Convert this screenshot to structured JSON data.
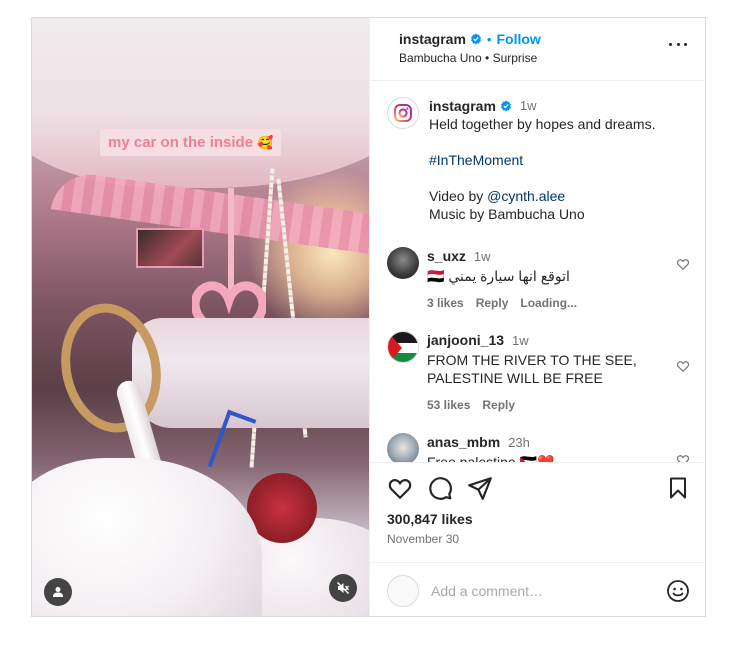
{
  "media": {
    "caption_sticker": "my car on the inside",
    "caption_emoji": "🥰"
  },
  "header": {
    "username": "instagram",
    "separator": "•",
    "follow_label": "Follow",
    "subline": "Bambucha Uno • Surprise"
  },
  "caption": {
    "username": "instagram",
    "time": "1w",
    "line1": "Held together by hopes and dreams.",
    "hashtag": "#InTheMoment",
    "video_by_prefix": "Video by ",
    "video_by_handle": "@cynth.alee",
    "music_by": "Music by Bambucha Uno"
  },
  "comments": [
    {
      "username": "s_uxz",
      "time": "1w",
      "flag": "🇾🇪",
      "text": "اتوقع انها سيارة يمني",
      "likes": "3 likes",
      "reply": "Reply",
      "loading": "Loading..."
    },
    {
      "username": "janjooni_13",
      "time": "1w",
      "text": "FROM THE RIVER TO THE SEE, PALESTINE WILL BE FREE",
      "likes": "53 likes",
      "reply": "Reply"
    },
    {
      "username": "anas_mbm",
      "time": "23h",
      "text": "Free palestine 🇵🇸❤️"
    }
  ],
  "actions": {
    "likes": "300,847 likes",
    "date": "November 30"
  },
  "comment_box": {
    "placeholder": "Add a comment…"
  },
  "colors": {
    "accent": "#0095f6",
    "link": "#00376b",
    "muted": "#737373",
    "border": "#dbdbdb"
  },
  "icons": [
    "user-tag-icon",
    "mute-icon",
    "verified-badge-icon",
    "more-options-icon",
    "instagram-logo-icon",
    "heart-icon",
    "comment-icon",
    "share-icon",
    "bookmark-icon",
    "emoji-icon"
  ]
}
